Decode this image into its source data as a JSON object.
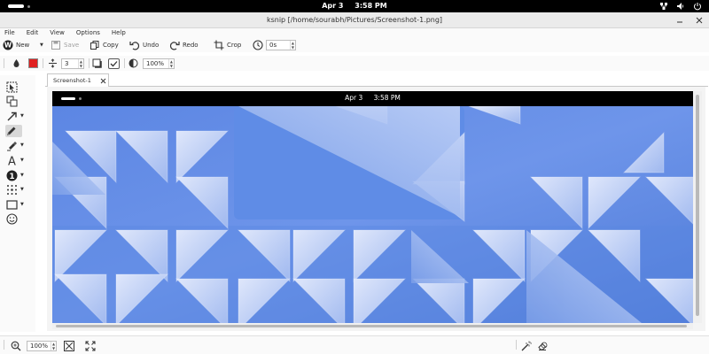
{
  "topbar": {
    "date": "Apr 3",
    "time": "3:58 PM",
    "icons": [
      "network-icon",
      "volume-icon",
      "power-icon"
    ]
  },
  "window": {
    "title": "ksnip [/home/sourabh/Pictures/Screenshot-1.png]",
    "controls": [
      "minimize-icon",
      "close-icon"
    ]
  },
  "menu": {
    "file": "File",
    "edit": "Edit",
    "view": "View",
    "options": "Options",
    "help": "Help"
  },
  "toolbar": {
    "new_label": "New",
    "save_label": "Save",
    "copy_label": "Copy",
    "undo_label": "Undo",
    "redo_label": "Redo",
    "crop_label": "Crop",
    "delay_value": "0s"
  },
  "settings": {
    "color": "#e02020",
    "width_value": "3",
    "opacity_value": "100%"
  },
  "tools": [
    "select-icon",
    "duplicate-icon",
    "arrow-icon",
    "pen-icon",
    "marker-icon",
    "text-icon",
    "number-icon",
    "blur-icon",
    "rectangle-icon",
    "sticker-icon"
  ],
  "tab": {
    "label": "Screenshot-1"
  },
  "screenshot": {
    "date": "Apr 3",
    "time": "3:58 PM"
  },
  "statusbar": {
    "zoom_value": "100%"
  },
  "colors": {
    "accent": "#e02020",
    "wallpaper": "#5a86e0"
  }
}
